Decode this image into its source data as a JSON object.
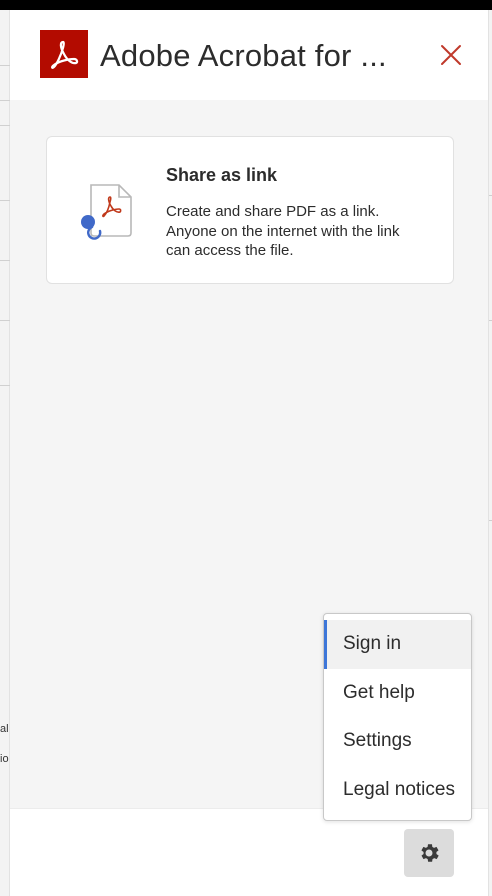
{
  "header": {
    "title": "Adobe Acrobat for ...",
    "logo_icon": "acrobat-logo-icon",
    "close_icon": "close-icon"
  },
  "card": {
    "title": "Share as link",
    "description": "Create and share PDF as a link. Anyone on the internet with the link can access the file.",
    "icon": "share-pdf-link-icon"
  },
  "menu": {
    "items": [
      {
        "label": "Sign in",
        "active": true
      },
      {
        "label": "Get help",
        "active": false
      },
      {
        "label": "Settings",
        "active": false
      },
      {
        "label": "Legal notices",
        "active": false
      }
    ]
  },
  "footer": {
    "gear_icon": "gear-icon"
  },
  "background": {
    "left_fragments": [
      "al",
      "io"
    ]
  },
  "colors": {
    "brand": "#b30b00",
    "close": "#c0392b",
    "accent": "#3d76d8",
    "link_icon": "#4069c8"
  }
}
